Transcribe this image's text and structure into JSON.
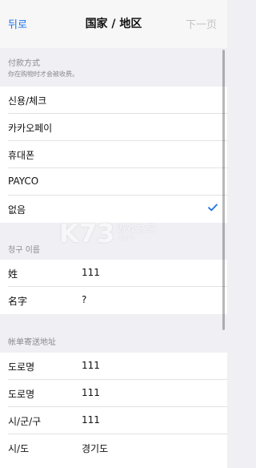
{
  "nav": {
    "back_label": "뒤로",
    "title": "国家 / 地区",
    "next_label": "下一页"
  },
  "payment": {
    "header_title": "付款方式",
    "header_sub": "你在购物时才会被收费。",
    "options": [
      {
        "label": "신용/체크",
        "selected": false
      },
      {
        "label": "카카오페이",
        "selected": false
      },
      {
        "label": "휴대폰",
        "selected": false
      },
      {
        "label": "PAYCO",
        "selected": false
      },
      {
        "label": "없음",
        "selected": true
      }
    ]
  },
  "billing_name": {
    "header_title": "청구 이름",
    "rows": [
      {
        "label": "姓",
        "value": "111"
      },
      {
        "label": "名字",
        "value": "?"
      }
    ]
  },
  "billing_address": {
    "header_title": "帐单寄送地址",
    "rows": [
      {
        "label": "도로명",
        "value": "111"
      },
      {
        "label": "도로명",
        "value": "111"
      },
      {
        "label": "시/군/구",
        "value": "111"
      },
      {
        "label": "시/도",
        "value": "경기도"
      }
    ]
  },
  "watermark": {
    "logo_text": "K73",
    "site_name": "游戏之家",
    "url": ".com"
  },
  "colors": {
    "accent": "#1a73e8",
    "background": "#efeff4",
    "disabled": "#c4c4c8",
    "section_text": "#8a8a8e"
  }
}
